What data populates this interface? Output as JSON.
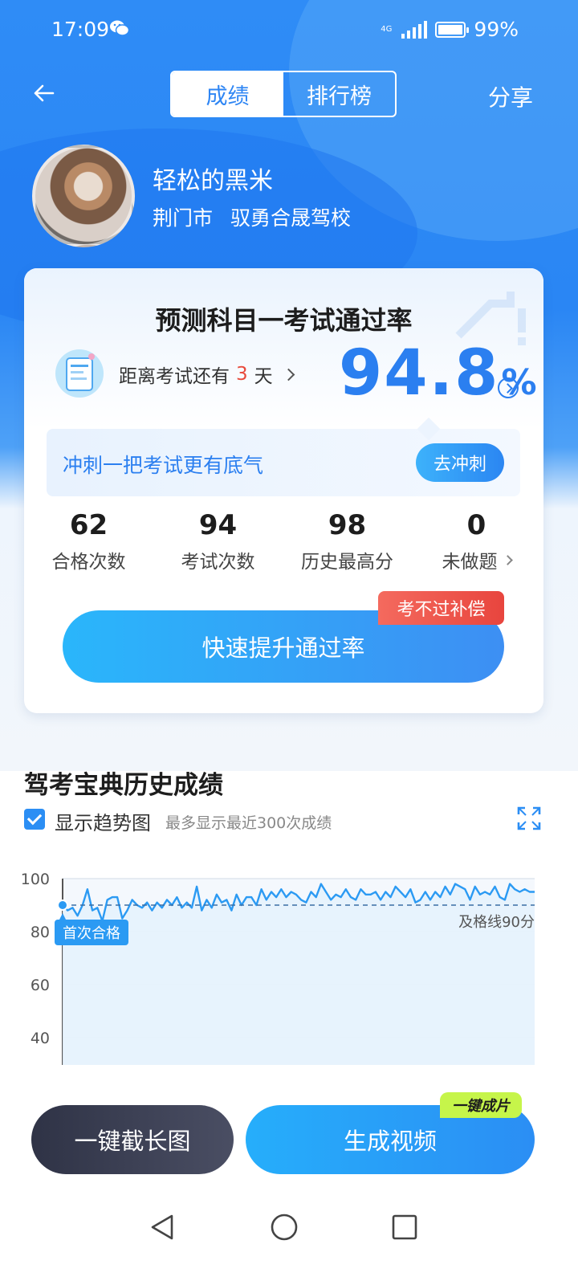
{
  "status": {
    "time": "17:09",
    "network": "4G",
    "battery": "99%"
  },
  "header": {
    "tabs": [
      "成绩",
      "排行榜"
    ],
    "active_tab": 0,
    "share": "分享"
  },
  "user": {
    "name": "轻松的黑米",
    "city": "荆门市",
    "school": "驭勇合晟驾校"
  },
  "card": {
    "title": "预测科目一考试通过率",
    "countdown_prefix": "距离考试还有",
    "countdown_days": "3",
    "countdown_suffix": "天",
    "pass_rate": "94.8",
    "pass_rate_unit": "%",
    "sprint_text": "冲刺一把考试更有底气",
    "sprint_button": "去冲刺",
    "stats": [
      {
        "value": "62",
        "label": "合格次数"
      },
      {
        "value": "94",
        "label": "考试次数"
      },
      {
        "value": "98",
        "label": "历史最高分"
      },
      {
        "value": "0",
        "label": "未做题"
      }
    ],
    "compensation_tag": "考不过补偿",
    "boost_button": "快速提升通过率"
  },
  "history": {
    "title": "驾考宝典历史成绩",
    "trend_checked": true,
    "trend_label": "显示趋势图",
    "trend_note": "最多显示最近300次成绩"
  },
  "chart_data": {
    "type": "line",
    "y_ticks": [
      "100",
      "80",
      "60",
      "40"
    ],
    "ylim": [
      30,
      100
    ],
    "pass_line": 90,
    "pass_line_label": "及格线90分",
    "first_pass_label": "首次合格",
    "grid": true,
    "values": [
      90,
      88,
      89,
      86,
      90,
      96,
      88,
      89,
      84,
      92,
      93,
      93,
      85,
      88,
      92,
      90,
      89,
      91,
      88,
      91,
      89,
      92,
      90,
      93,
      89,
      91,
      89,
      97,
      88,
      92,
      89,
      94,
      91,
      92,
      88,
      94,
      90,
      93,
      93,
      90,
      96,
      92,
      95,
      93,
      96,
      93,
      95,
      94,
      92,
      91,
      95,
      93,
      98,
      95,
      92,
      94,
      93,
      96,
      93,
      92,
      96,
      94,
      94,
      95,
      92,
      95,
      93,
      97,
      95,
      93,
      96,
      91,
      92,
      95,
      92,
      95,
      93,
      97,
      94,
      98,
      97,
      96,
      92,
      97,
      94,
      95,
      94,
      97,
      93,
      92,
      98,
      96,
      95,
      96,
      95,
      95
    ]
  },
  "bottom": {
    "screenshot_button": "一键截长图",
    "video_button": "生成视频",
    "video_tag": "一键成片"
  }
}
